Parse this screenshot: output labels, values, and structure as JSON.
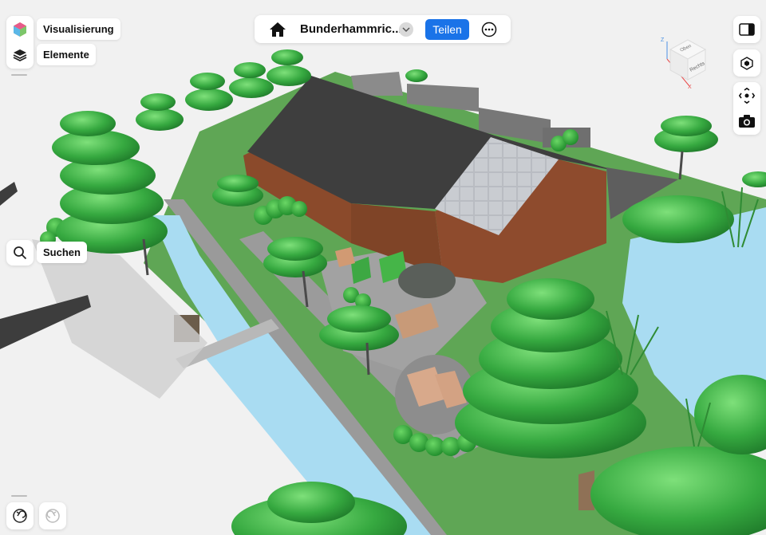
{
  "toolbar_left": {
    "visualization_label": "Visualisierung",
    "elements_label": "Elemente",
    "search_label": "Suchen"
  },
  "topbar": {
    "project_title": "Bunderhammric...",
    "share_label": "Teilen"
  },
  "viewcube": {
    "top_label": "Oben",
    "right_label": "Rechts",
    "axis_z": "Z",
    "axis_x": "X"
  },
  "colors": {
    "accent": "#1a73e8",
    "water": "#a9dcf2",
    "grass": "#5fa655",
    "tree": "#3eb44a",
    "brick": "#8b4a2b",
    "roof": "#3e3e3e"
  }
}
